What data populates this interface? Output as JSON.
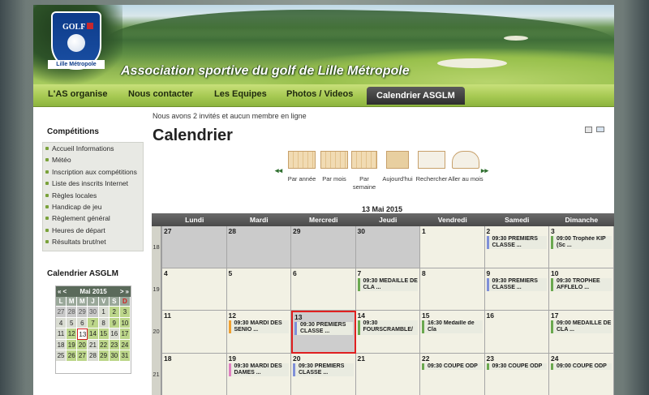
{
  "site": {
    "title": "Association sportive du golf de Lille Métropole",
    "logo_top": "GOLF",
    "logo_bottom": "Lille Métropole"
  },
  "nav": {
    "items": [
      "L'AS organise",
      "Nous contacter",
      "Les Equipes",
      "Photos / Videos",
      "Calendrier ASGLM"
    ],
    "active": "Calendrier ASGLM"
  },
  "sidebar": {
    "competitions_title": "Compétitions",
    "menu": [
      "Accueil Informations",
      "Météo",
      "Inscription aux compétitions",
      "Liste des inscrits Internet",
      "Règles locales",
      "Handicap de jeu",
      "Règlement général",
      "Heures de départ",
      "Résultats brut/net"
    ],
    "calendar_title": "Calendrier ASGLM",
    "mini_calendar": {
      "month": "Mai 2015",
      "prev_year": "«",
      "prev_month": "<",
      "next_month": ">",
      "next_year": "»",
      "day_headers": [
        "L",
        "M",
        "M",
        "J",
        "V",
        "S",
        "D"
      ],
      "rows": [
        [
          "27",
          "28",
          "29",
          "30",
          "1",
          "2",
          "3"
        ],
        [
          "4",
          "5",
          "6",
          "7",
          "8",
          "9",
          "10"
        ],
        [
          "11",
          "12",
          "13",
          "14",
          "15",
          "16",
          "17"
        ],
        [
          "18",
          "19",
          "20",
          "21",
          "22",
          "23",
          "24"
        ],
        [
          "25",
          "26",
          "27",
          "28",
          "29",
          "30",
          "31"
        ]
      ]
    }
  },
  "main": {
    "online_text": "Nous avons 2 invités et aucun membre en ligne",
    "page_title": "Calendrier",
    "view_buttons": [
      "Par année",
      "Par mois",
      "Par semaine",
      "Aujourd'hui",
      "Rechercher",
      "Aller au mois"
    ],
    "current_date": "13 Mai 2015",
    "day_names": [
      "Lundi",
      "Mardi",
      "Mercredi",
      "Jeudi",
      "Vendredi",
      "Samedi",
      "Dimanche"
    ],
    "weeks": [
      {
        "num": "18",
        "days": [
          {
            "d": "27",
            "ev": ""
          },
          {
            "d": "28",
            "ev": ""
          },
          {
            "d": "29",
            "ev": ""
          },
          {
            "d": "30",
            "ev": ""
          },
          {
            "d": "1",
            "ev": ""
          },
          {
            "d": "2",
            "ev": "09:30 PREMIERS CLASSE ..."
          },
          {
            "d": "3",
            "ev": "09:00 Trophée KIP (Sc ..."
          }
        ]
      },
      {
        "num": "19",
        "days": [
          {
            "d": "4",
            "ev": ""
          },
          {
            "d": "5",
            "ev": ""
          },
          {
            "d": "6",
            "ev": ""
          },
          {
            "d": "7",
            "ev": "09:30 MEDAILLE DE CLA ..."
          },
          {
            "d": "8",
            "ev": ""
          },
          {
            "d": "9",
            "ev": "09:30 PREMIERS CLASSE ..."
          },
          {
            "d": "10",
            "ev": "09:30 TROPHEE AFFLELO ..."
          }
        ]
      },
      {
        "num": "20",
        "days": [
          {
            "d": "11",
            "ev": ""
          },
          {
            "d": "12",
            "ev": "09:30 MARDI DES SENIO ..."
          },
          {
            "d": "13",
            "ev": "09:30 PREMIERS CLASSE ..."
          },
          {
            "d": "14",
            "ev": "09:30 FOURSCRAMBLE/ ..."
          },
          {
            "d": "15",
            "ev": "16:30 Medaille de Cla"
          },
          {
            "d": "16",
            "ev": ""
          },
          {
            "d": "17",
            "ev": "09:00 MEDAILLE DE CLA ..."
          }
        ]
      },
      {
        "num": "21",
        "days": [
          {
            "d": "18",
            "ev": ""
          },
          {
            "d": "19",
            "ev": "09:30 MARDI DES DAMES ..."
          },
          {
            "d": "20",
            "ev": "09:30 PREMIERS CLASSE ..."
          },
          {
            "d": "21",
            "ev": ""
          },
          {
            "d": "22",
            "ev": "09:30 COUPE ODP"
          },
          {
            "d": "23",
            "ev": "09:30 COUPE ODP"
          },
          {
            "d": "24",
            "ev": "09:00 COUPE ODP"
          }
        ]
      }
    ]
  }
}
